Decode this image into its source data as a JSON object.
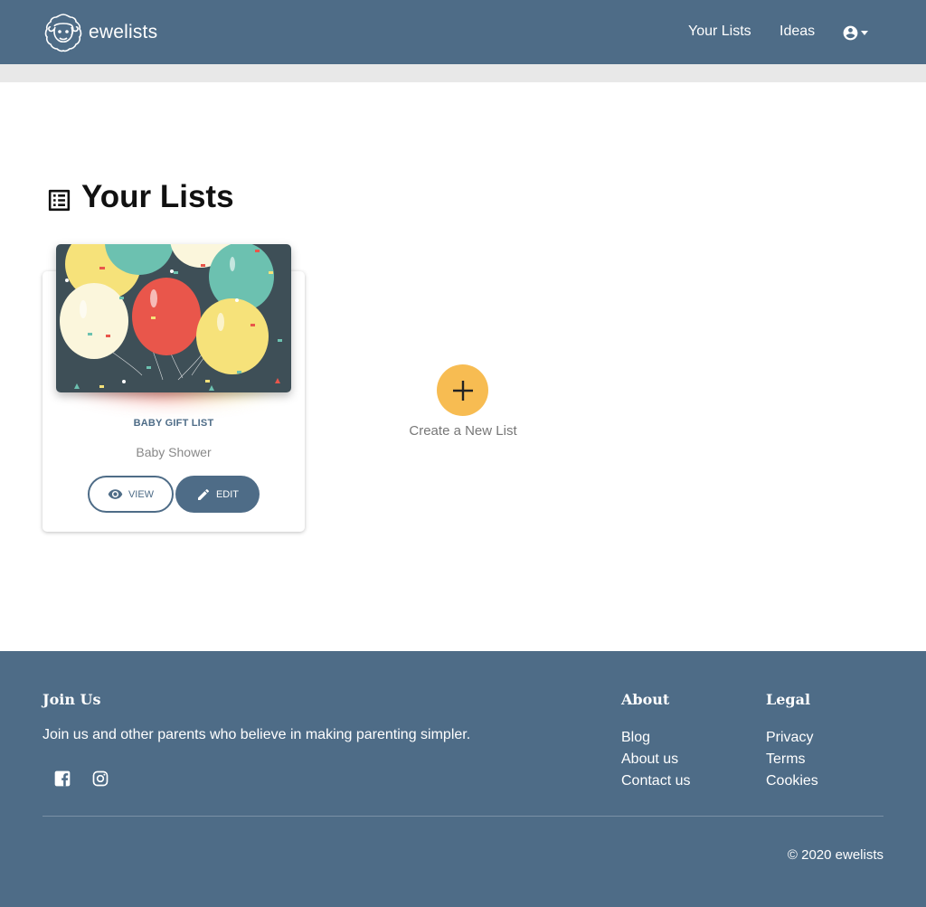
{
  "header": {
    "brand_name": "ewelists",
    "nav": [
      "Your Lists",
      "Ideas"
    ],
    "account_icon": "account-circle-icon"
  },
  "page": {
    "title": "Your Lists",
    "title_icon": "list-icon"
  },
  "lists": [
    {
      "title": "BABY GIFT LIST",
      "occasion": "Baby Shower",
      "image": "balloons-image",
      "view_label": "VIEW",
      "edit_label": "EDIT"
    }
  ],
  "create": {
    "label": "Create a New List",
    "icon": "plus-icon"
  },
  "footer": {
    "join_heading": "Join Us",
    "join_text": "Join us and other parents who believe in making parenting simpler.",
    "social": [
      "facebook-icon",
      "instagram-icon"
    ],
    "about_heading": "About",
    "about_links": [
      "Blog",
      "About us",
      "Contact us"
    ],
    "legal_heading": "Legal",
    "legal_links": [
      "Privacy",
      "Terms",
      "Cookies"
    ],
    "copyright": "© 2020 ewelists"
  },
  "colors": {
    "primary": "#4e6c87",
    "accent": "#f7bc52",
    "background": "#ffffff"
  }
}
